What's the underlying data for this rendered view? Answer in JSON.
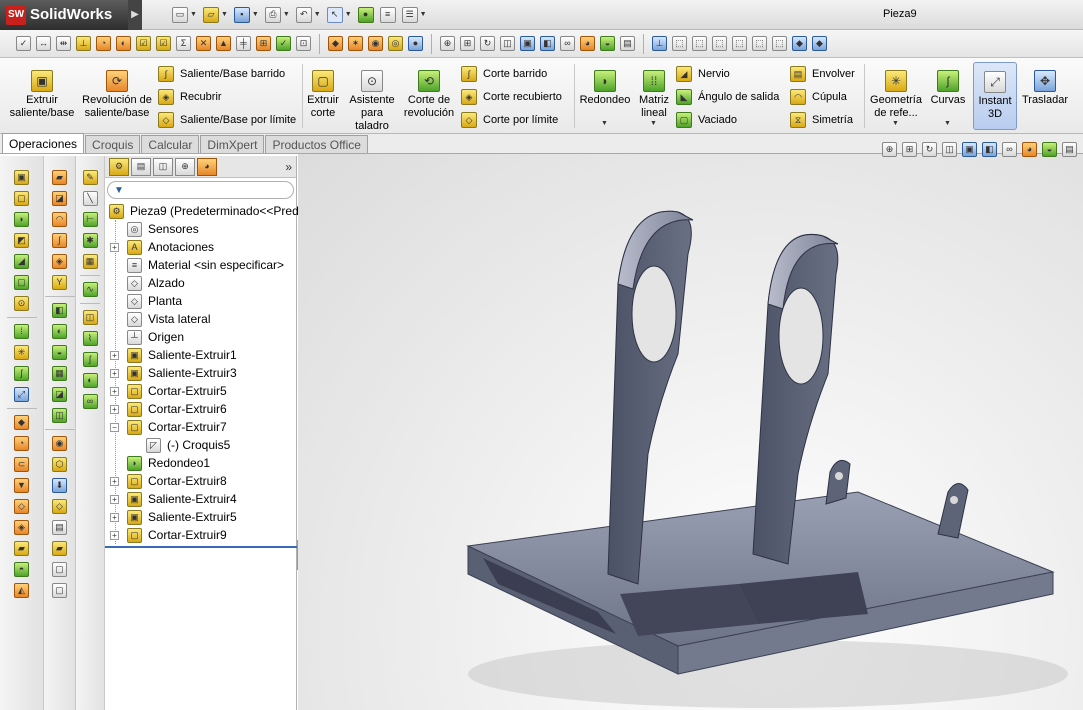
{
  "app": {
    "name": "SolidWorks",
    "document_title": "Pieza9"
  },
  "command_manager": {
    "extruir_saliente": "Extruir saliente/base",
    "revolucion": "Revolución de saliente/base",
    "saliente_barrido": "Saliente/Base barrido",
    "recubrir": "Recubrir",
    "saliente_limite": "Saliente/Base por límite",
    "extruir_corte": "Extruir corte",
    "asistente_taladro": "Asistente para taladro",
    "corte_revolucion": "Corte de revolución",
    "corte_barrido": "Corte barrido",
    "corte_recubierto": "Corte recubierto",
    "corte_limite": "Corte por límite",
    "redondeo": "Redondeo",
    "matriz_lineal": "Matriz lineal",
    "nervio": "Nervio",
    "angulo_salida": "Ángulo de salida",
    "vaciado": "Vaciado",
    "envolver": "Envolver",
    "cupula": "Cúpula",
    "simetria": "Simetría",
    "geometria_ref": "Geometría de refe...",
    "curvas": "Curvas",
    "instant3d": "Instant 3D",
    "trasladar": "Trasladar"
  },
  "tabs": [
    "Operaciones",
    "Croquis",
    "Calcular",
    "DimXpert",
    "Productos Office"
  ],
  "feature_tree": {
    "root": "Pieza9  (Predeterminado<<Pred",
    "items": [
      {
        "label": "Sensores",
        "expandable": false
      },
      {
        "label": "Anotaciones",
        "expandable": true
      },
      {
        "label": "Material <sin especificar>",
        "expandable": false
      },
      {
        "label": "Alzado",
        "expandable": false
      },
      {
        "label": "Planta",
        "expandable": false
      },
      {
        "label": "Vista lateral",
        "expandable": false
      },
      {
        "label": "Origen",
        "expandable": false
      },
      {
        "label": "Saliente-Extruir1",
        "expandable": true
      },
      {
        "label": "Saliente-Extruir3",
        "expandable": true
      },
      {
        "label": "Cortar-Extruir5",
        "expandable": true
      },
      {
        "label": "Cortar-Extruir6",
        "expandable": true
      },
      {
        "label": "Cortar-Extruir7",
        "expandable": true,
        "expanded": true
      },
      {
        "label": "(-) Croquis5",
        "expandable": false,
        "child": true
      },
      {
        "label": "Redondeo1",
        "expandable": false
      },
      {
        "label": "Cortar-Extruir8",
        "expandable": true
      },
      {
        "label": "Saliente-Extruir4",
        "expandable": true
      },
      {
        "label": "Saliente-Extruir5",
        "expandable": true
      },
      {
        "label": "Cortar-Extruir9",
        "expandable": true
      }
    ]
  },
  "icons": {
    "logo": "solidworks-logo",
    "model": "3d-part-bracket"
  }
}
